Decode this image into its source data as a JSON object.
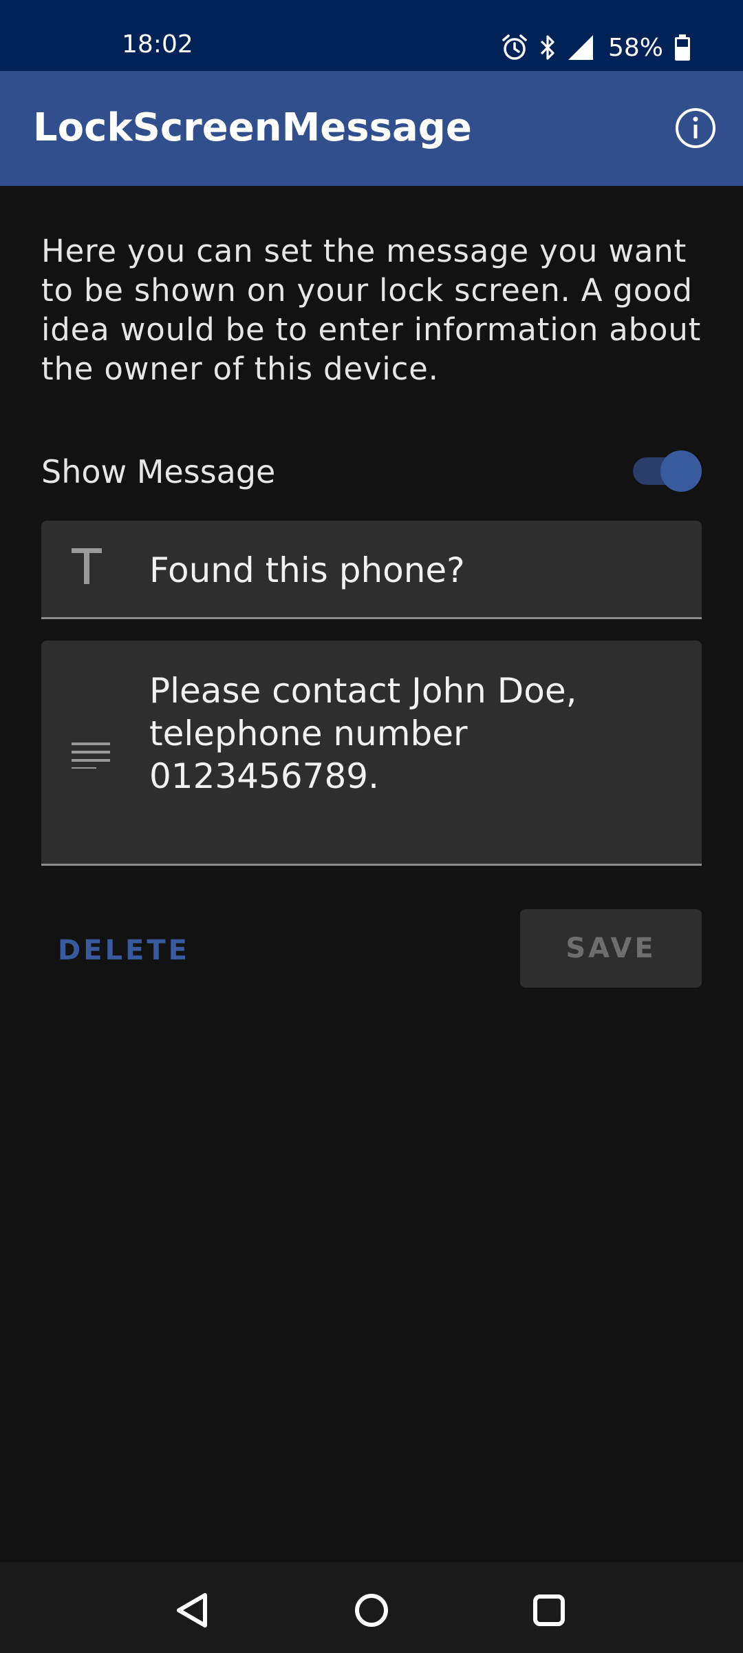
{
  "status_bar": {
    "time": "18:02",
    "battery_percent": "58%",
    "icons": [
      "alarm-icon",
      "bluetooth-icon",
      "signal-icon",
      "battery-icon"
    ]
  },
  "app_bar": {
    "title": "LockScreenMessage",
    "info_icon": "info-icon"
  },
  "main": {
    "description": "Here you can set the message you want to be shown on your lock screen. A good idea would be to enter information about the owner of this device.",
    "show_message": {
      "label": "Show Message",
      "enabled": true
    },
    "title_field": {
      "icon": "title-text-icon",
      "value": "Found this phone?"
    },
    "body_field": {
      "icon": "notes-lines-icon",
      "value": "Please contact John Doe, telephone number 0123456789."
    },
    "delete_label": "DELETE",
    "save_label": "SAVE"
  },
  "nav_bar": {
    "icons": [
      "back-icon",
      "home-icon",
      "recents-icon"
    ]
  },
  "colors": {
    "status_bar": "#002256",
    "app_bar": "#314f8c",
    "background": "#121212",
    "accent": "#3a5a9e"
  }
}
